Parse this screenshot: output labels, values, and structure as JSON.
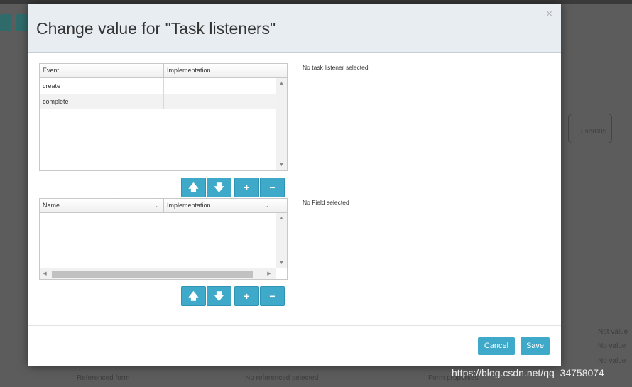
{
  "dialog": {
    "title": "Change value for \"Task listeners\"",
    "close_glyph": "×"
  },
  "listeners_grid": {
    "columns": [
      "Event",
      "Implementation"
    ],
    "rows": [
      {
        "event": "create",
        "implementation": ""
      },
      {
        "event": "complete",
        "implementation": ""
      }
    ],
    "status": "No task listener selected"
  },
  "fields_grid": {
    "columns": [
      "Name",
      "Implementation"
    ],
    "rows": [],
    "status": "No Field selected"
  },
  "toolbar_icons": {
    "move_up": "arrow-up-icon",
    "move_down": "arrow-down-icon",
    "add": "plus-icon",
    "remove": "minus-icon"
  },
  "footer": {
    "cancel_label": "Cancel",
    "save_label": "Save"
  },
  "background": {
    "node_label": "user005",
    "texts": [
      "Not value",
      "No value",
      "No value",
      "Referenced form",
      "No referenced selected",
      "Form properties"
    ]
  },
  "watermark": "https://blog.csdn.net/qq_34758074",
  "colors": {
    "accent": "#3ea9c9",
    "header_bg": "#e8edf1",
    "row_alt": "#f2f2f2"
  }
}
